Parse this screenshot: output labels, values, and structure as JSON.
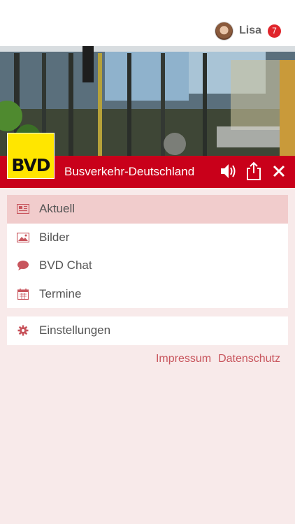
{
  "header": {
    "user_name": "Lisa",
    "notification_count": "7"
  },
  "brand": {
    "logo_text": "BVD",
    "title": "Busverkehr-Deutschland",
    "color": "#c9001a",
    "logo_color": "#ffe600"
  },
  "menu": {
    "items": [
      {
        "label": "Aktuell",
        "icon": "newspaper-icon",
        "active": true
      },
      {
        "label": "Bilder",
        "icon": "image-icon",
        "active": false
      },
      {
        "label": "BVD Chat",
        "icon": "chat-bubble-icon",
        "active": false
      },
      {
        "label": "Termine",
        "icon": "calendar-icon",
        "active": false
      }
    ],
    "settings": {
      "label": "Einstellungen",
      "icon": "gear-icon"
    }
  },
  "footer": {
    "impressum": "Impressum",
    "datenschutz": "Datenschutz"
  },
  "colors": {
    "background": "#f8eaea",
    "accent": "#c8555d",
    "active_row": "#f1cccc"
  }
}
